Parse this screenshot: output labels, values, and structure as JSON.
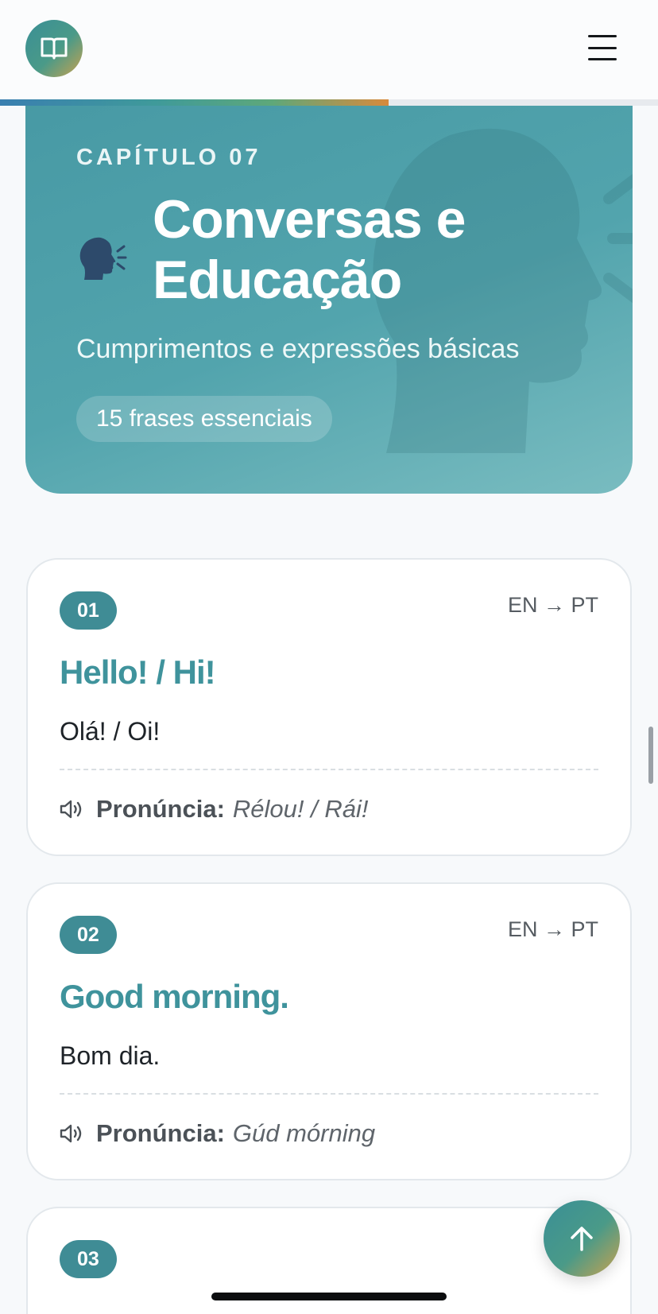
{
  "header": {
    "logo_icon": "open-book-icon",
    "menu_icon": "hamburger-menu-icon",
    "reading_progress": 0.59,
    "colors": {
      "accent": "#3f8c95",
      "gradient_end": "#c9a24f"
    }
  },
  "hero": {
    "chapter_label": "CAPÍTULO 07",
    "emoji_icon": "speaking-head-icon",
    "title": "Conversas e Educação",
    "subtitle": "Cumprimentos e expressões básicas",
    "badge": "15 frases essenciais"
  },
  "phrases": [
    {
      "number": "01",
      "direction": "EN → PT",
      "english": "Hello! / Hi!",
      "portuguese": "Olá! / Oi!",
      "pron_label": "Pronúncia:",
      "pronunciation": "Rélou! / Rái!"
    },
    {
      "number": "02",
      "direction": "EN → PT",
      "english": "Good morning.",
      "portuguese": "Bom dia.",
      "pron_label": "Pronúncia:",
      "pronunciation": "Gúd mórning"
    },
    {
      "number": "03",
      "direction": "EN"
    }
  ],
  "back_to_top_icon": "arrow-up-icon"
}
